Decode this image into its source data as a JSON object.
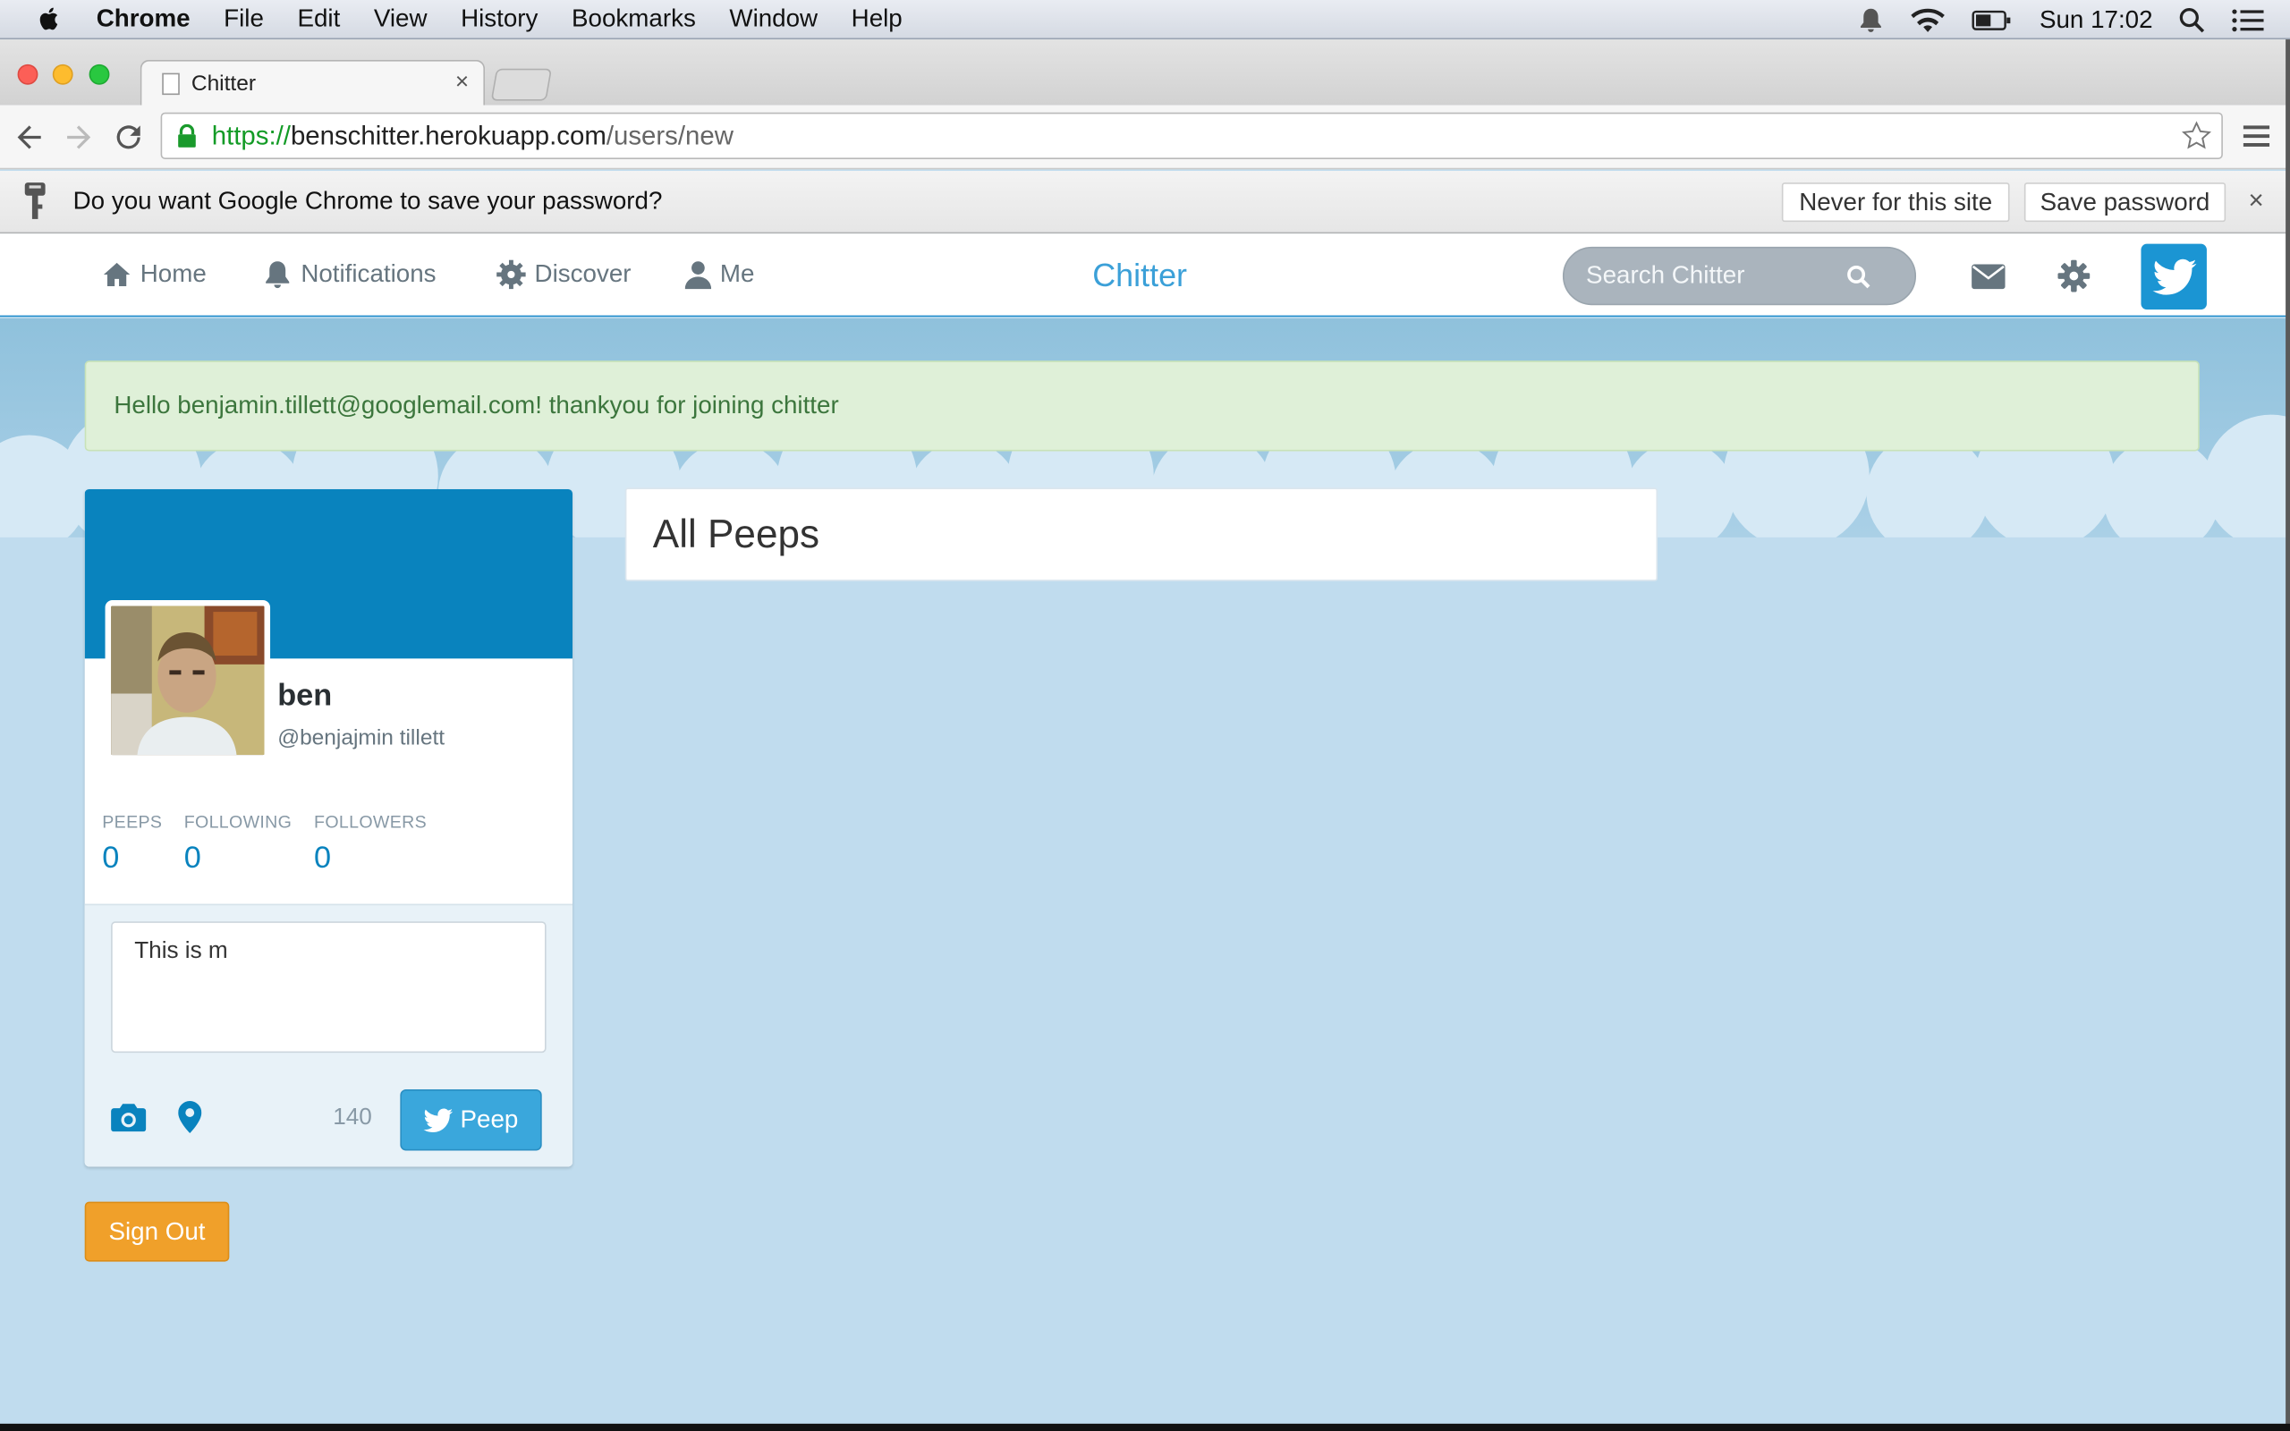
{
  "menubar": {
    "app": "Chrome",
    "items": [
      "File",
      "Edit",
      "View",
      "History",
      "Bookmarks",
      "Window",
      "Help"
    ],
    "clock": "Sun 17:02"
  },
  "browser": {
    "tab_title": "Chitter",
    "tab_close": "×",
    "url": {
      "scheme": "https://",
      "host": "benschitter.herokuapp.com",
      "path": "/users/new"
    }
  },
  "infobar": {
    "message": "Do you want Google Chrome to save your password?",
    "never_label": "Never for this site",
    "save_label": "Save password",
    "close": "×"
  },
  "nav": {
    "home": "Home",
    "notifications": "Notifications",
    "discover": "Discover",
    "me": "Me",
    "brand": "Chitter",
    "search_placeholder": "Search Chitter"
  },
  "alert": {
    "message": "Hello benjamin.tillett@googlemail.com! thankyou for joining chitter"
  },
  "profile": {
    "name": "ben",
    "handle": "@benjajmin tillett",
    "stats": [
      {
        "label": "PEEPS",
        "value": "0"
      },
      {
        "label": "FOLLOWING",
        "value": "0"
      },
      {
        "label": "FOLLOWERS",
        "value": "0"
      }
    ]
  },
  "composer": {
    "text": "This is m",
    "char_count": "140",
    "peep_label": "Peep"
  },
  "signout_label": "Sign Out",
  "peeps": {
    "heading": "All Peeps"
  },
  "colors": {
    "accent": "#0983be",
    "brand": "#3ba0d8",
    "alert_bg": "#dff0d8",
    "signout": "#f0a02a",
    "page_bg": "#c0dcee"
  }
}
